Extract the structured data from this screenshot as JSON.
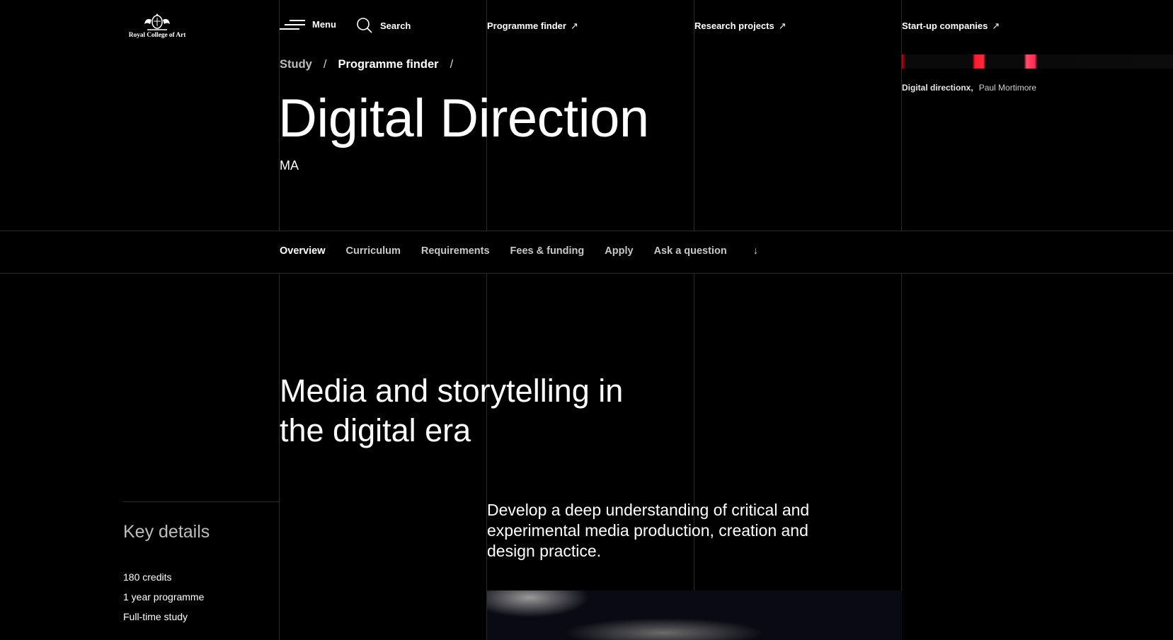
{
  "header": {
    "logo_text": "Royal College of Art",
    "menu_label": "Menu",
    "search_label": "Search",
    "links": [
      {
        "label": "Programme finder",
        "icon": "external-arrow-icon"
      },
      {
        "label": "Research projects",
        "icon": "external-arrow-icon"
      },
      {
        "label": "Start-up companies",
        "icon": "external-arrow-icon"
      }
    ],
    "arrow_glyph": "↗"
  },
  "breadcrumb": {
    "items": [
      "Study",
      "Programme finder"
    ],
    "separator": "/"
  },
  "hero": {
    "title": "Digital Direction",
    "degree": "MA",
    "image_caption_title": "Digital directionx,",
    "image_caption_author": "Paul Mortimore",
    "image_accent": "#ff1a2e"
  },
  "subnav": {
    "items": [
      "Overview",
      "Curriculum",
      "Requirements",
      "Fees & funding",
      "Apply",
      "Ask a question"
    ],
    "active": "Overview",
    "ask_arrow": "↓"
  },
  "content": {
    "headline": "Media and storytelling in the digital era",
    "intro": "Develop a deep understanding of critical and experimental media production, creation and design practice.",
    "key_details_title": "Key details",
    "key_details": [
      "180 credits",
      "1 year programme",
      "Full-time study"
    ]
  }
}
